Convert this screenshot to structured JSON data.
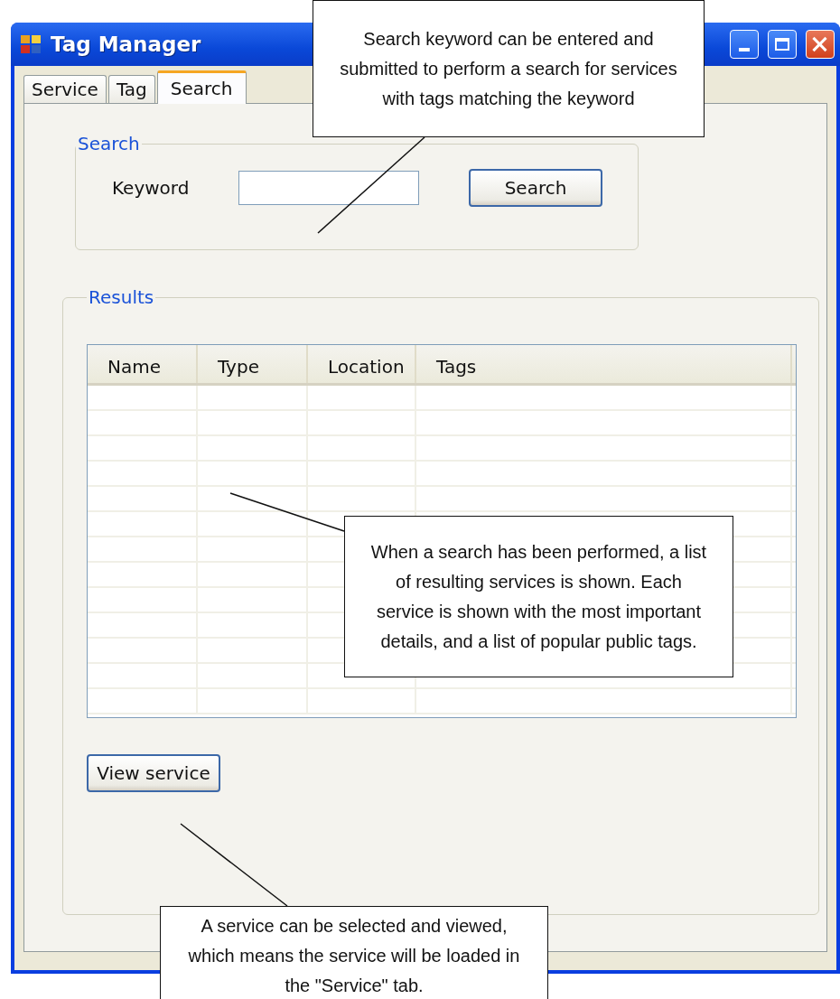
{
  "window": {
    "title": "Tag Manager"
  },
  "tabs": [
    {
      "label": "Service",
      "selected": false
    },
    {
      "label": "Tag",
      "selected": false
    },
    {
      "label": "Search",
      "selected": true
    }
  ],
  "search_group": {
    "title": "Search",
    "label": "Keyword",
    "button": "Search"
  },
  "results_group": {
    "title": "Results",
    "table": {
      "columns": [
        "Name",
        "Type",
        "Location",
        "Tags"
      ]
    },
    "button": "View service"
  },
  "callouts": [
    {
      "text": "Search keyword can be entered and submitted to perform a search for services with tags matching the keyword"
    },
    {
      "text": "When a search has been performed, a list of resulting services is shown. Each service is shown with the most important details, and a list of popular public tags."
    },
    {
      "text": "A service can be selected and viewed, which means the service will be loaded in the \"Service\" tab."
    }
  ]
}
